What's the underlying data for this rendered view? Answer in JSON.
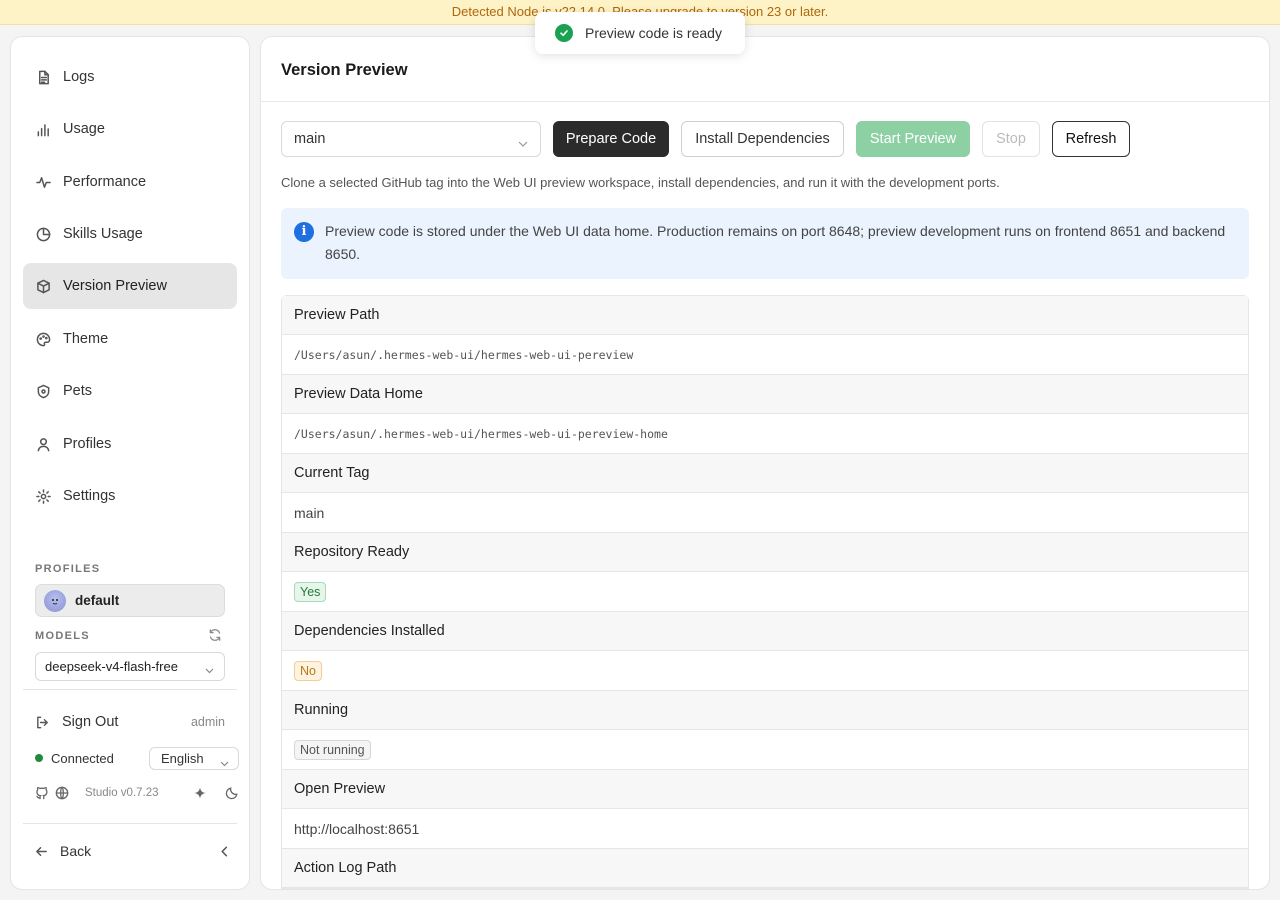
{
  "banner": {
    "text": "Detected Node is v22.14.0. Please upgrade to version 23 or later."
  },
  "toast": {
    "text": "Preview code is ready",
    "icon": "check-circle-icon",
    "color": "#1aa152"
  },
  "sidebar": {
    "items": [
      {
        "label": "Logs",
        "icon": "file-text-icon"
      },
      {
        "label": "Usage",
        "icon": "bar-chart-icon"
      },
      {
        "label": "Performance",
        "icon": "activity-icon"
      },
      {
        "label": "Skills Usage",
        "icon": "pie-chart-icon"
      },
      {
        "label": "Version Preview",
        "icon": "box-icon",
        "active": true
      },
      {
        "label": "Theme",
        "icon": "palette-icon"
      },
      {
        "label": "Pets",
        "icon": "shield-icon"
      },
      {
        "label": "Profiles",
        "icon": "user-icon"
      },
      {
        "label": "Settings",
        "icon": "gear-icon"
      }
    ],
    "profiles_label": "PROFILES",
    "profile_name": "default",
    "models_label": "MODELS",
    "model_value": "deepseek-v4-flash-free",
    "sign_out": "Sign Out",
    "user": "admin",
    "status": "Connected",
    "language": "English",
    "version": "Studio v0.7.23",
    "back": "Back"
  },
  "main": {
    "title": "Version Preview",
    "tag_value": "main",
    "buttons": {
      "prepare": "Prepare Code",
      "install": "Install Dependencies",
      "start": "Start Preview",
      "stop": "Stop",
      "refresh": "Refresh"
    },
    "description": "Clone a selected GitHub tag into the Web UI preview workspace, install dependencies, and run it with the development ports.",
    "info": "Preview code is stored under the Web UI data home. Production remains on port 8648; preview development runs on frontend 8651 and backend 8650.",
    "rows": [
      {
        "label": "Preview Path",
        "value": "/Users/asun/.hermes-web-ui/hermes-web-ui-pereview"
      },
      {
        "label": "Preview Data Home",
        "value": "/Users/asun/.hermes-web-ui/hermes-web-ui-pereview-home"
      },
      {
        "label": "Current Tag",
        "value": "main"
      },
      {
        "label": "Repository Ready",
        "value": "Yes"
      },
      {
        "label": "Dependencies Installed",
        "value": "No"
      },
      {
        "label": "Running",
        "value": "Not running"
      },
      {
        "label": "Open Preview",
        "value": "http://localhost:8651"
      },
      {
        "label": "Action Log Path"
      }
    ]
  },
  "colors": {
    "accent_dark": "#2b2b2b",
    "start_green": "#8dd0a4",
    "info_bg": "#ebf3fe",
    "connected": "#1f8a3b"
  }
}
